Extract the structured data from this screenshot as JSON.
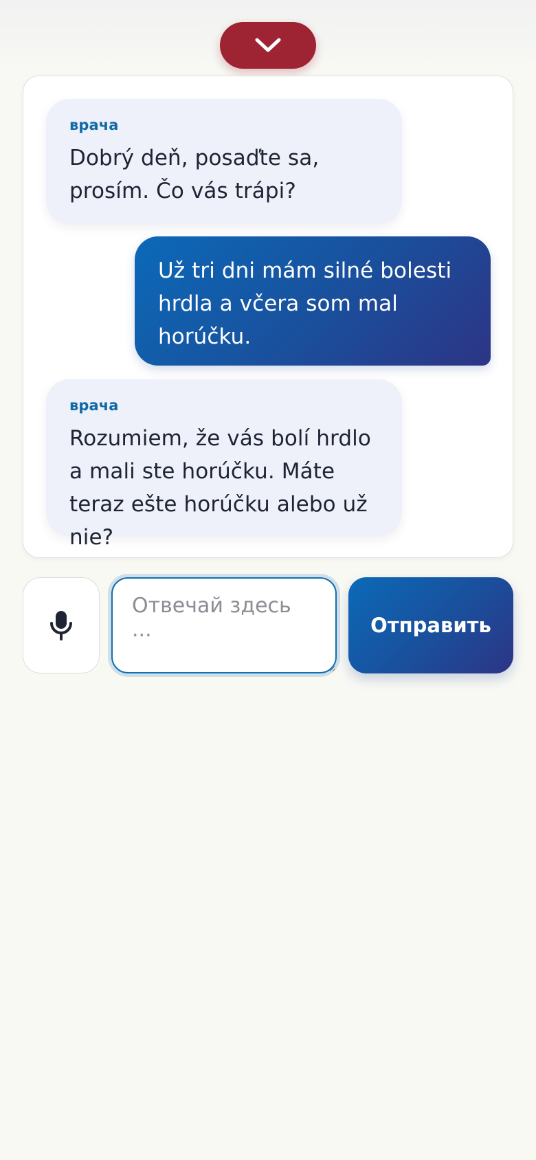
{
  "header": {
    "collapse_icon": "chevron-down-icon",
    "accent_color": "#9e2333"
  },
  "chat": {
    "messages": [
      {
        "role": "doctor",
        "sender": "врача",
        "text": "Dobrý deň, posaďte sa, prosím. Čo vás trápi?"
      },
      {
        "role": "user",
        "text": "Už tri dni mám silné bolesti hrdla a včera som mal horúčku."
      },
      {
        "role": "doctor",
        "sender": "врача",
        "text": "Rozumiem, že vás bolí hrdlo a mali ste horúčku. Máte teraz ešte horúčku alebo už nie?"
      }
    ]
  },
  "composer": {
    "mic_icon": "microphone-icon",
    "input_placeholder": "Отвечай здесь ...",
    "input_value": "",
    "send_label": "Отправить"
  },
  "colors": {
    "doctor_bubble": "#eef0fa",
    "user_bubble_start": "#0b6ab8",
    "user_bubble_end": "#2d3485",
    "sender_label": "#116aa5"
  }
}
